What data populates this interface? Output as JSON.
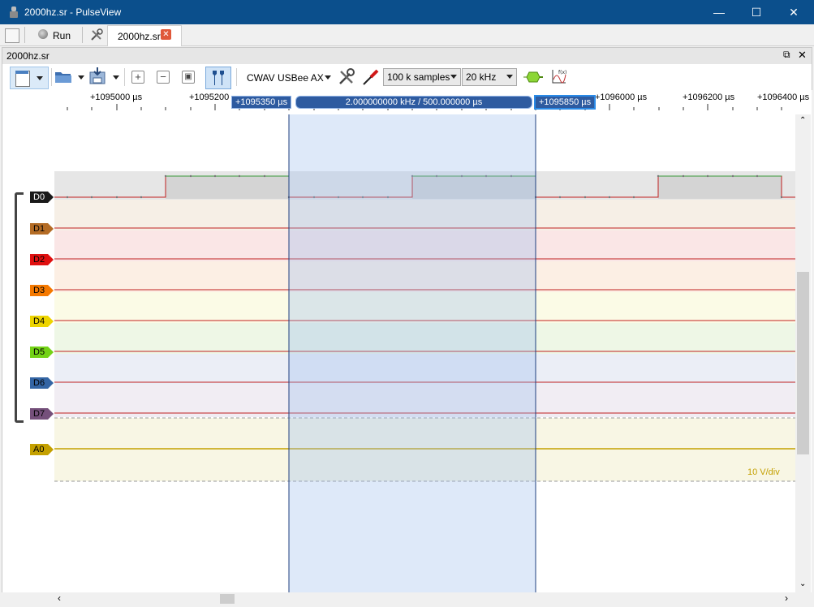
{
  "window": {
    "title": "2000hz.sr - PulseView"
  },
  "tabs": {
    "run_label": "Run",
    "doc_tab_label": "2000hz.sr"
  },
  "session": {
    "title": "2000hz.sr"
  },
  "toolbar": {
    "device": "CWAV USBee AX",
    "samples": "100 k samples",
    "rate": "20 kHz"
  },
  "ruler": {
    "labels": [
      "+1095000 µs",
      "+1095200",
      "+1096000 µs",
      "+1096200 µs",
      "+1096400 µs"
    ]
  },
  "cursors": {
    "left": "+1095350 µs",
    "right": "+1095850 µs",
    "measurement": "2.000000000 kHz / 500.000000 µs"
  },
  "channels": [
    {
      "name": "D0",
      "color": "#1a1a1a",
      "text": "#ffffff"
    },
    {
      "name": "D1",
      "color": "#8b4513",
      "text": "#000000"
    },
    {
      "name": "D2",
      "color": "#e01010",
      "text": "#000000"
    },
    {
      "name": "D3",
      "color": "#f57900",
      "text": "#000000"
    },
    {
      "name": "D4",
      "color": "#edd400",
      "text": "#000000"
    },
    {
      "name": "D5",
      "color": "#73d216",
      "text": "#000000"
    },
    {
      "name": "D6",
      "color": "#3465a4",
      "text": "#000000"
    },
    {
      "name": "D7",
      "color": "#75507b",
      "text": "#000000"
    },
    {
      "name": "A0",
      "color": "#c4a000",
      "text": "#000000"
    }
  ],
  "analog": {
    "scale": "10 V/div"
  }
}
